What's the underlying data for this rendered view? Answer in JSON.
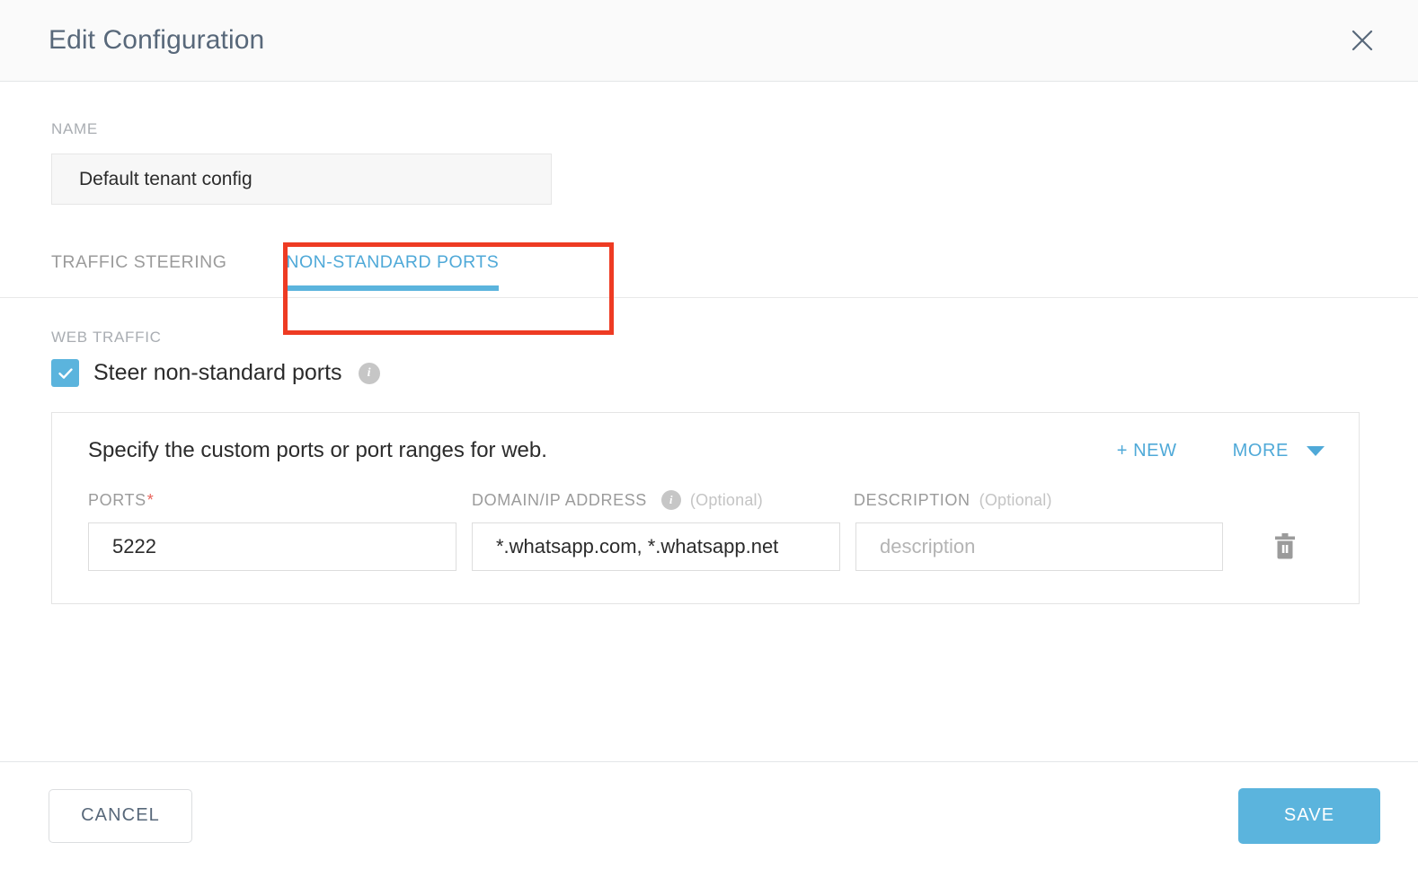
{
  "header": {
    "title": "Edit Configuration",
    "close_icon": "close-icon"
  },
  "name_section": {
    "label": "NAME",
    "value": "Default tenant config"
  },
  "tabs": [
    {
      "label": "TRAFFIC STEERING",
      "active": false
    },
    {
      "label": "NON-STANDARD PORTS",
      "active": true
    }
  ],
  "web_traffic": {
    "label": "WEB TRAFFIC",
    "checkbox_label": "Steer non-standard ports",
    "checked": true,
    "info_icon": "info-icon",
    "info_glyph": "i"
  },
  "ports_panel": {
    "description": "Specify the custom ports or port ranges for web.",
    "new_label": "+ NEW",
    "more_label": "MORE",
    "caret_icon": "chevron-down-icon",
    "columns": {
      "ports": "PORTS",
      "ports_required_mark": "*",
      "domain": "DOMAIN/IP ADDRESS",
      "domain_optional": "(Optional)",
      "description": "DESCRIPTION",
      "description_optional": "(Optional)",
      "domain_info_glyph": "i"
    },
    "rows": [
      {
        "ports": "5222",
        "domain": "*.whatsapp.com, *.whatsapp.net",
        "description": "",
        "description_placeholder": "description",
        "delete_icon": "trash-icon"
      }
    ]
  },
  "footer": {
    "cancel_label": "CANCEL",
    "save_label": "SAVE"
  },
  "annotation": {
    "type": "highlight-box",
    "target": "tab-non-standard-ports",
    "color": "#ee3b23"
  },
  "colors": {
    "accent_blue": "#5bb4dd",
    "link_blue": "#4fa9d8",
    "title_slate": "#58687a",
    "muted_gray": "#9b9b9b",
    "annotation_red": "#ee3b23",
    "required_red": "#e8625a"
  }
}
